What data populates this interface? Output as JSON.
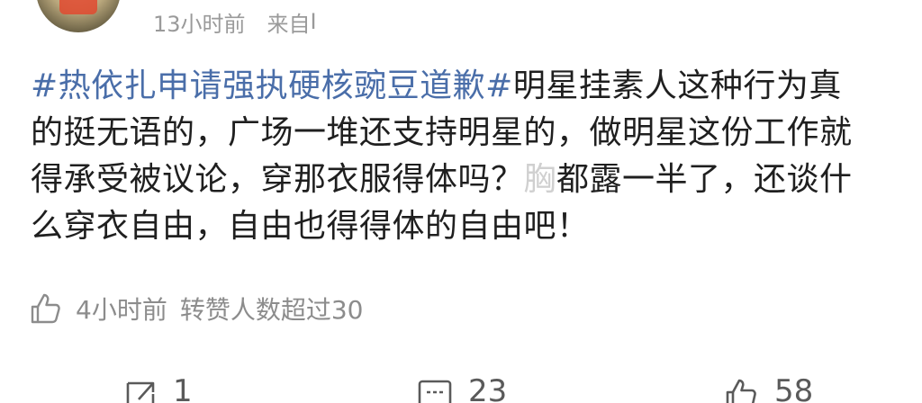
{
  "post": {
    "time": "13小时前",
    "source_prefix": "来自",
    "source_name": "I",
    "hashtag": "#热依扎申请强执硬核豌豆道歉#",
    "lines": {
      "l1_rest": "明星挂素人这种行为真",
      "l2": "的挺无语的，广场一堆还支持明星的，做明星这份工作就",
      "l3_a": "得承受被议论，穿那衣服得体吗？",
      "l3_blur": "胸",
      "l3_b": "都露一半了，还谈什",
      "l4": "么穿衣自由，自由也得得体的自由吧！"
    }
  },
  "like_info": {
    "icon": "thumb-up-outline-icon",
    "time": "4小时前",
    "text": "转赞人数超过30"
  },
  "actions": {
    "repost": {
      "icon": "repost-icon",
      "count": "1"
    },
    "comment": {
      "icon": "comment-icon",
      "count": "23"
    },
    "like": {
      "icon": "like-icon",
      "count": "58"
    }
  },
  "colors": {
    "hashtag": "#4a6ea9",
    "text": "#1f1f1f",
    "meta": "#9a9a9a"
  }
}
